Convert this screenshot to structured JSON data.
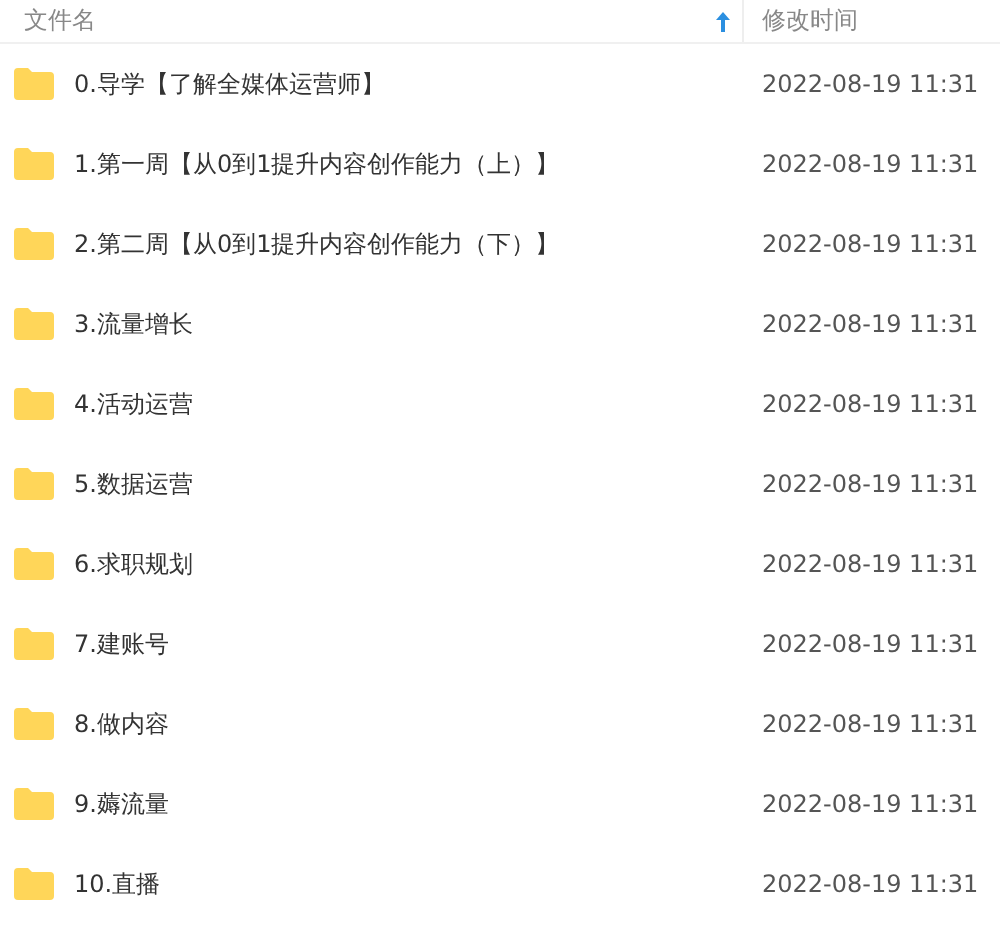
{
  "columns": [
    {
      "label": "文件名",
      "sorted_ascending": true
    },
    {
      "label": "修改时间"
    }
  ],
  "rows": [
    {
      "name": "0.导学【了解全媒体运营师】",
      "modified": "2022-08-19 11:31"
    },
    {
      "name": "1.第一周【从0到1提升内容创作能力（上）】",
      "modified": "2022-08-19 11:31"
    },
    {
      "name": "2.第二周【从0到1提升内容创作能力（下）】",
      "modified": "2022-08-19 11:31"
    },
    {
      "name": "3.流量增长",
      "modified": "2022-08-19 11:31"
    },
    {
      "name": "4.活动运营",
      "modified": "2022-08-19 11:31"
    },
    {
      "name": "5.数据运营",
      "modified": "2022-08-19 11:31"
    },
    {
      "name": "6.求职规划",
      "modified": "2022-08-19 11:31"
    },
    {
      "name": "7.建账号",
      "modified": "2022-08-19 11:31"
    },
    {
      "name": "8.做内容",
      "modified": "2022-08-19 11:31"
    },
    {
      "name": "9.薅流量",
      "modified": "2022-08-19 11:31"
    },
    {
      "name": "10.直播",
      "modified": "2022-08-19 11:31"
    }
  ]
}
